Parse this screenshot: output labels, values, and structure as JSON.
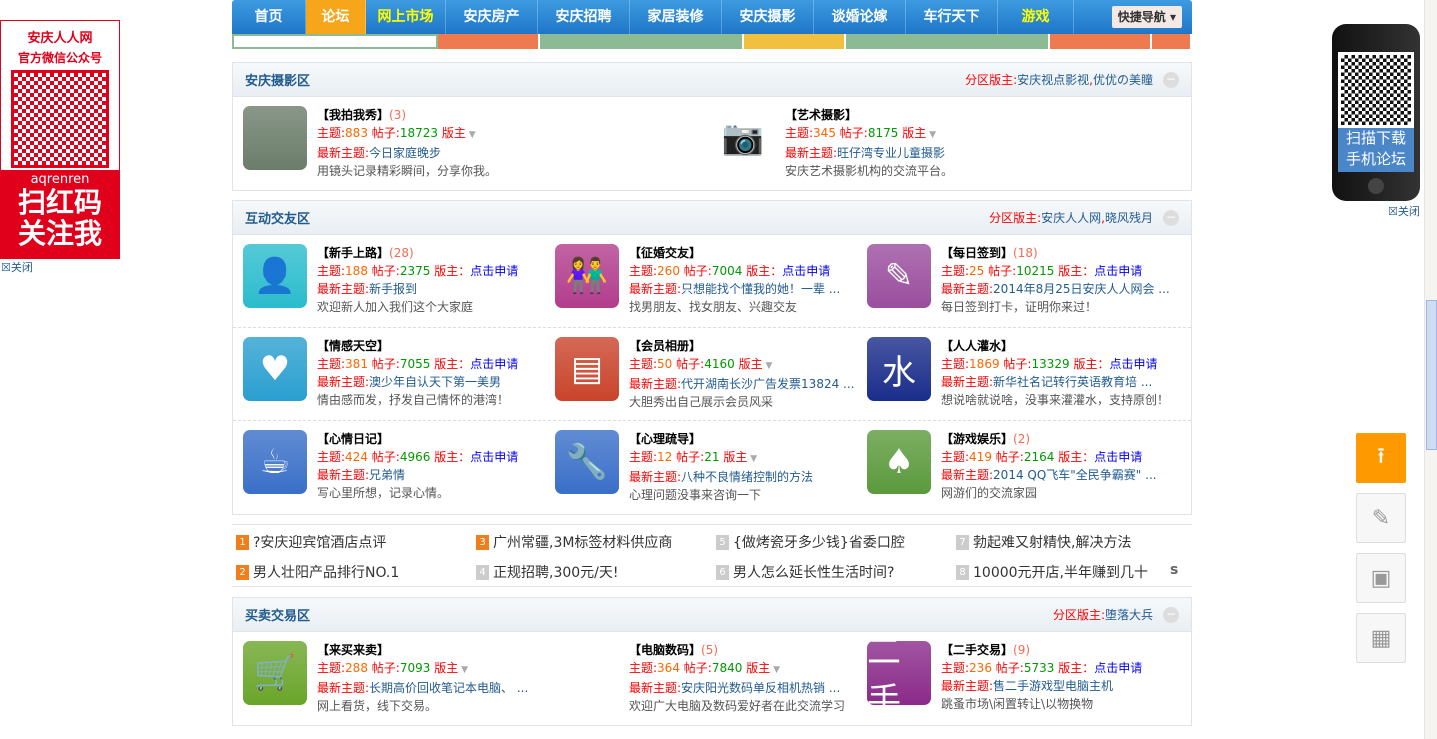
{
  "nav": {
    "items": [
      {
        "label": "首页"
      },
      {
        "label": "论坛",
        "active": true
      },
      {
        "label": "网上市场",
        "yellow": true
      },
      {
        "label": "安庆房产"
      },
      {
        "label": "安庆招聘"
      },
      {
        "label": "家居装修"
      },
      {
        "label": "安庆摄影"
      },
      {
        "label": "谈婚论嫁"
      },
      {
        "label": "车行天下"
      },
      {
        "label": "游戏",
        "yellow": true
      }
    ],
    "quick_nav": "快捷导航 ▾"
  },
  "left_ad": {
    "line1": "安庆人人网",
    "line2": "官方微信公众号",
    "handle": "aqrenren",
    "slogan1": "扫红码",
    "slogan2": "关注我",
    "close": "☒关闭"
  },
  "right_ad": {
    "line1": "扫描下载",
    "line2": "手机论坛",
    "close": "☒关闭"
  },
  "labels": {
    "topics": "主题:",
    "posts": "帖子:",
    "mod": "版主",
    "mod_colon": "版主：",
    "latest": "最新主题:",
    "apply": "点击申请",
    "zone_mod": "分区版主:"
  },
  "sections": [
    {
      "title": "安庆摄影区",
      "mods": [
        "安庆视点影视",
        "优优の美瞳"
      ],
      "cols": 2,
      "forums": [
        {
          "name": "【我拍我秀】",
          "count": "(3)",
          "topics": "883",
          "posts": "18723",
          "mod": "dropdown",
          "latest": "今日家庭晚步",
          "desc": "用镜头记录精彩瞬间，分享你我。",
          "icon": "photographer-photo",
          "color": "#6b7d6a"
        },
        {
          "name": "【艺术摄影】",
          "count": "",
          "topics": "345",
          "posts": "8175",
          "mod": "dropdown",
          "latest": "旺仔湾专业儿童摄影",
          "desc": "安庆艺术摄影机构的交流平台。",
          "icon": "camera-icon",
          "color": "#444"
        }
      ]
    },
    {
      "title": "互动交友区",
      "mods": [
        "安庆人人网",
        "晓风残月"
      ],
      "cols": 3,
      "forums": [
        {
          "name": "【新手上路】",
          "count": "(28)",
          "topics": "188",
          "posts": "2375",
          "mod": "apply",
          "latest": "新手报到",
          "desc": "欢迎新人加入我们这个大家庭",
          "icon": "user-icon",
          "color": "#2bbccd"
        },
        {
          "name": "【征婚交友】",
          "count": "",
          "topics": "260",
          "posts": "7004",
          "mod": "apply",
          "latest": "只想能找个懂我的她！一辈 ...",
          "desc": "找男朋友、找女朋友、兴趣交友",
          "icon": "couple-icon",
          "color": "#b23d8d"
        },
        {
          "name": "【每日签到】",
          "count": "(18)",
          "topics": "25",
          "posts": "10215",
          "mod": "apply",
          "latest": "2014年8月25日安庆人人网会 ...",
          "desc": "每日签到打卡，证明你来过！",
          "icon": "pencil-icon",
          "color": "#9a4e9e"
        },
        {
          "name": "【情感天空】",
          "count": "",
          "topics": "381",
          "posts": "7055",
          "mod": "apply",
          "latest": "澳少年自认天下第一美男",
          "desc": "情由感而发，抒发自己情怀的港湾！",
          "icon": "heart-icon",
          "color": "#2a9fd0"
        },
        {
          "name": "【会员相册】",
          "count": "",
          "topics": "50",
          "posts": "4160",
          "mod": "dropdown",
          "latest": "代开湖南长沙广告发票13824 ...",
          "desc": "大胆秀出自己展示会员风采",
          "icon": "album-icon",
          "color": "#c9442b"
        },
        {
          "name": "【人人灌水】",
          "count": "",
          "topics": "1869",
          "posts": "13329",
          "mod": "apply",
          "latest": "新华社名记转行英语教育培 ...",
          "desc": "想说啥就说啥，没事来灌灌水，支持原创！",
          "icon": "water-icon",
          "color": "#1a2d8a"
        },
        {
          "name": "【心情日记】",
          "count": "",
          "topics": "424",
          "posts": "4966",
          "mod": "apply",
          "latest": "兄弟情",
          "desc": "写心里所想，记录心情。",
          "icon": "coffee-cup-icon",
          "color": "#3a6fc8"
        },
        {
          "name": "【心理疏导】",
          "count": "",
          "topics": "12",
          "posts": "21",
          "mod": "dropdown",
          "latest": "八种不良情绪控制的方法",
          "desc": "心理问题没事来咨询一下",
          "icon": "wrench-icon",
          "color": "#3a6fc8"
        },
        {
          "name": "【游戏娱乐】",
          "count": "(2)",
          "topics": "419",
          "posts": "2164",
          "mod": "apply",
          "latest": "2014 QQ飞车\"全民争霸赛\" ...",
          "desc": "网游们的交流家园",
          "icon": "cards-icon",
          "color": "#5b9a3c"
        }
      ]
    },
    {
      "title": "买卖交易区",
      "mods": [
        "堕落大兵"
      ],
      "cols": 3,
      "forums": [
        {
          "name": "【来买来卖】",
          "count": "",
          "topics": "288",
          "posts": "7093",
          "mod": "dropdown",
          "latest": "长期高价回收笔记本电脑、 ...",
          "desc": "网上看货，线下交易。",
          "icon": "cart-icon",
          "color": "#6aa52a"
        },
        {
          "name": "【电脑数码】",
          "count": "(5)",
          "topics": "364",
          "posts": "7840",
          "mod": "dropdown",
          "latest": "安庆阳光数码单反相机热销 ...",
          "desc": "欢迎广大电脑及数码爱好者在此交流学习",
          "icon": "usb-icon",
          "color": "#222"
        },
        {
          "name": "【二手交易】",
          "count": "(9)",
          "topics": "236",
          "posts": "5733",
          "mod": "apply",
          "latest": "售二手游戏型电脑主机",
          "desc": "跳蚤市场\\闲置转让\\以物换物",
          "icon": "secondhand-photo",
          "color": "#8a2a8a"
        }
      ]
    }
  ],
  "hot_links": [
    {
      "n": "1",
      "text": "?安庆迎宾馆酒店点评",
      "hot": true
    },
    {
      "n": "3",
      "text": "广州常疆,3M标签材料供应商",
      "hot": true
    },
    {
      "n": "5",
      "text": "{做烤瓷牙多少钱}省委口腔"
    },
    {
      "n": "7",
      "text": "勃起难又射精快,解决方法"
    },
    {
      "n": "2",
      "text": "男人壮阳产品排行NO.1",
      "hot": true
    },
    {
      "n": "4",
      "text": "正规招聘,300元/天!"
    },
    {
      "n": "6",
      "text": "男人怎么延长性生活时间?"
    },
    {
      "n": "8",
      "text": "10000元开店,半年赚到几十"
    }
  ],
  "colors": {
    "nav": "#1f76c8",
    "active": "#f7a61b",
    "accent": "#f00",
    "link": "#225b8f",
    "top_button": "#f90"
  }
}
